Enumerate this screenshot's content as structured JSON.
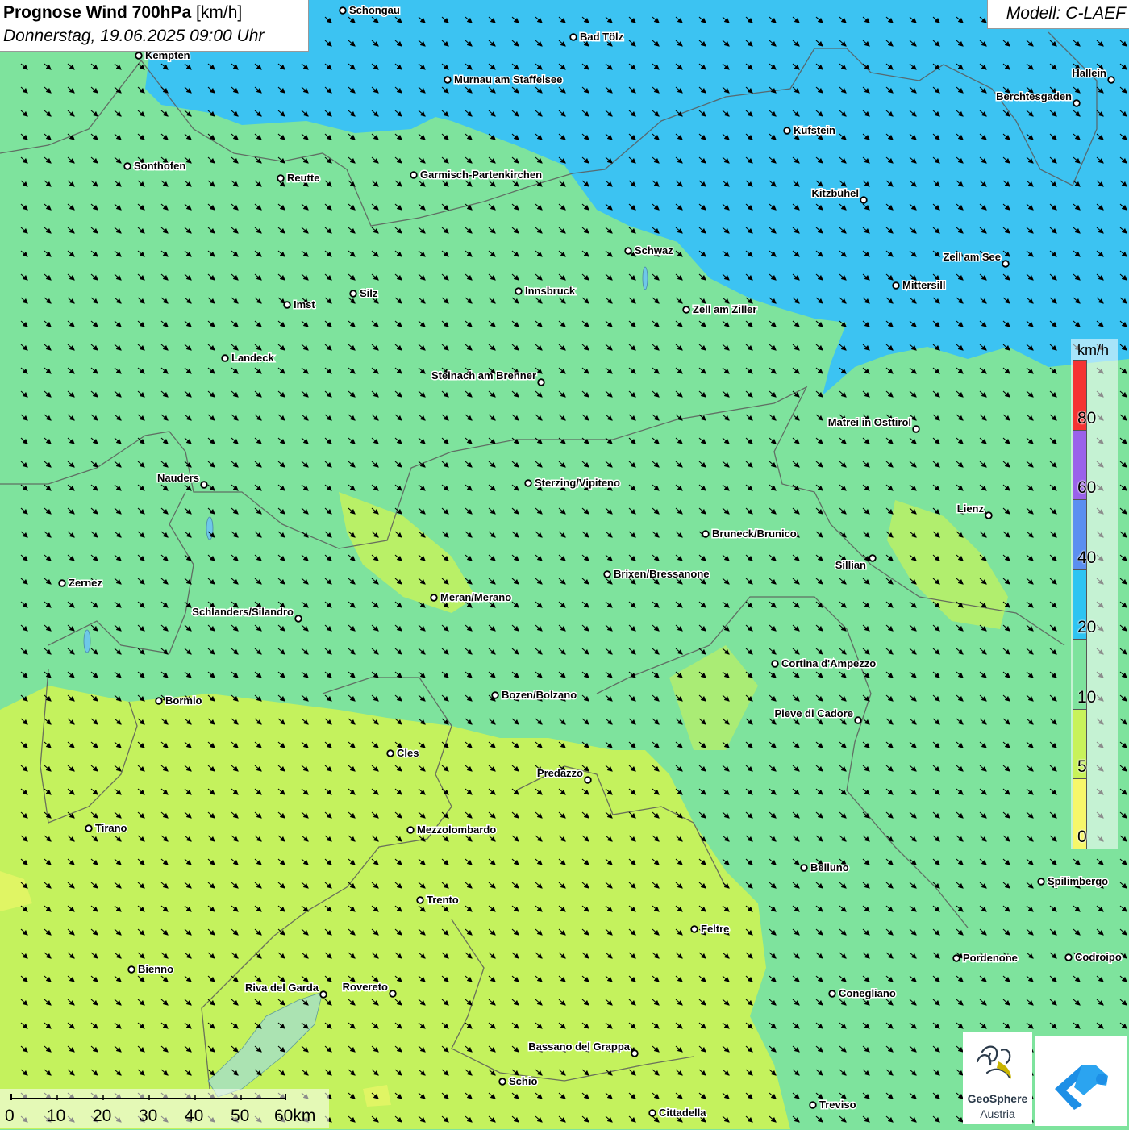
{
  "header": {
    "title_bold": "Prognose Wind 700hPa",
    "title_unit": "[km/h]",
    "datetime": "Donnerstag, 19.06.2025 09:00 Uhr"
  },
  "model_label": "Modell: C-LAEF",
  "legend": {
    "unit": "km/h",
    "bins": [
      {
        "label": "0",
        "color": "#f7f76a"
      },
      {
        "label": "5",
        "color": "#c8f25a"
      },
      {
        "label": "10",
        "color": "#7ee39d"
      },
      {
        "label": "20",
        "color": "#2ec4f2"
      },
      {
        "label": "40",
        "color": "#5b8ff0"
      },
      {
        "label": "60",
        "color": "#9a62ea"
      },
      {
        "label": "80",
        "color": "#f53333"
      }
    ]
  },
  "scale_bar": {
    "ticks": [
      "0",
      "10",
      "20",
      "30",
      "40",
      "50",
      "60km"
    ]
  },
  "wind_arrow_direction": "toward south-east",
  "cities": [
    {
      "id": "schongau",
      "name": "Schongau"
    },
    {
      "id": "bad-toelz",
      "name": "Bad Tölz"
    },
    {
      "id": "kempten",
      "name": "Kempten"
    },
    {
      "id": "murnau",
      "name": "Murnau am Staffelsee"
    },
    {
      "id": "hallein",
      "name": "Hallein"
    },
    {
      "id": "berchtesgaden",
      "name": "Berchtesgaden"
    },
    {
      "id": "kufstein",
      "name": "Kufstein"
    },
    {
      "id": "sonthofen",
      "name": "Sonthofen"
    },
    {
      "id": "reutte",
      "name": "Reutte"
    },
    {
      "id": "garmisch",
      "name": "Garmisch-Partenkirchen"
    },
    {
      "id": "kitzbuehel",
      "name": "Kitzbühel"
    },
    {
      "id": "schwaz",
      "name": "Schwaz"
    },
    {
      "id": "zell-am-see",
      "name": "Zell am See"
    },
    {
      "id": "mittersill",
      "name": "Mittersill"
    },
    {
      "id": "innsbruck",
      "name": "Innsbruck"
    },
    {
      "id": "silz",
      "name": "Silz"
    },
    {
      "id": "imst",
      "name": "Imst"
    },
    {
      "id": "zell-am-ziller",
      "name": "Zell am Ziller"
    },
    {
      "id": "landeck",
      "name": "Landeck"
    },
    {
      "id": "steinach",
      "name": "Steinach am Brenner"
    },
    {
      "id": "matrei",
      "name": "Matrei in Osttirol"
    },
    {
      "id": "nauders",
      "name": "Nauders"
    },
    {
      "id": "sterzing",
      "name": "Sterzing/Vipiteno"
    },
    {
      "id": "lienz",
      "name": "Lienz"
    },
    {
      "id": "bruneck",
      "name": "Bruneck/Brunico"
    },
    {
      "id": "sillian",
      "name": "Sillian"
    },
    {
      "id": "brixen",
      "name": "Brixen/Bressanone"
    },
    {
      "id": "zernez",
      "name": "Zernez"
    },
    {
      "id": "meran",
      "name": "Meran/Merano"
    },
    {
      "id": "schlanders",
      "name": "Schlanders/Silandro"
    },
    {
      "id": "cortina",
      "name": "Cortina d'Ampezzo"
    },
    {
      "id": "bozen",
      "name": "Bozen/Bolzano"
    },
    {
      "id": "bormio",
      "name": "Bormio"
    },
    {
      "id": "pieve",
      "name": "Pieve di Cadore"
    },
    {
      "id": "cles",
      "name": "Cles"
    },
    {
      "id": "predazzo",
      "name": "Predazzo"
    },
    {
      "id": "tirano",
      "name": "Tirano"
    },
    {
      "id": "mezzolombardo",
      "name": "Mezzolombardo"
    },
    {
      "id": "belluno",
      "name": "Belluno"
    },
    {
      "id": "spilimbergo",
      "name": "Spilimbergo"
    },
    {
      "id": "trento",
      "name": "Trento"
    },
    {
      "id": "feltre",
      "name": "Feltre"
    },
    {
      "id": "pordenone",
      "name": "Pordenone"
    },
    {
      "id": "codroipo",
      "name": "Codroipo"
    },
    {
      "id": "bienno",
      "name": "Bienno"
    },
    {
      "id": "riva",
      "name": "Riva del Garda"
    },
    {
      "id": "rovereto",
      "name": "Rovereto"
    },
    {
      "id": "conegliano",
      "name": "Conegliano"
    },
    {
      "id": "bassano",
      "name": "Bassano del Grappa"
    },
    {
      "id": "schio",
      "name": "Schio"
    },
    {
      "id": "treviso",
      "name": "Treviso"
    },
    {
      "id": "cittadella",
      "name": "Cittadella"
    }
  ],
  "logos": {
    "geosphere_line1": "GeoSphere",
    "geosphere_line2": "Austria"
  }
}
